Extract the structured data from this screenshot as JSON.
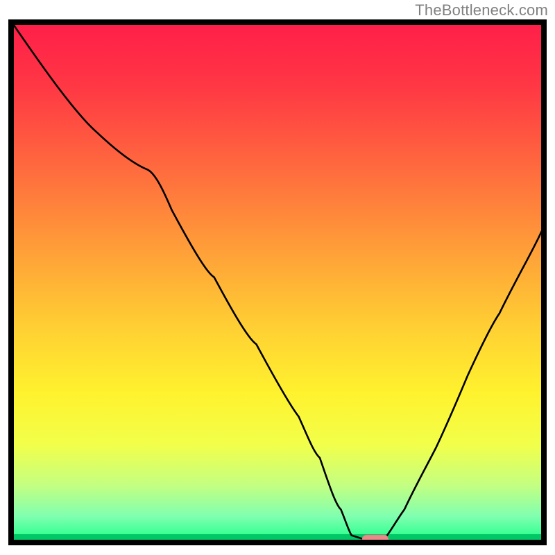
{
  "watermark": "TheBottleneck.com",
  "chart_data": {
    "type": "line",
    "title": "",
    "xlabel": "",
    "ylabel": "",
    "xlim": [
      0,
      100
    ],
    "ylim": [
      0,
      100
    ],
    "background_gradient": {
      "stops": [
        {
          "offset": 0.0,
          "color": "#ff1f49"
        },
        {
          "offset": 0.12,
          "color": "#ff3744"
        },
        {
          "offset": 0.28,
          "color": "#ff6a3e"
        },
        {
          "offset": 0.45,
          "color": "#ffa238"
        },
        {
          "offset": 0.6,
          "color": "#ffd233"
        },
        {
          "offset": 0.72,
          "color": "#fff22e"
        },
        {
          "offset": 0.82,
          "color": "#f2ff4a"
        },
        {
          "offset": 0.9,
          "color": "#c3ff82"
        },
        {
          "offset": 0.96,
          "color": "#7fffb0"
        },
        {
          "offset": 1.0,
          "color": "#2fff8f"
        }
      ]
    },
    "series": [
      {
        "name": "bottleneck-curve",
        "x": [
          0,
          8,
          16,
          24,
          25,
          30,
          38,
          46,
          54,
          58,
          62,
          64,
          67,
          70,
          74,
          80,
          86,
          92,
          100
        ],
        "y": [
          100,
          91,
          82,
          73,
          72,
          64,
          51,
          38,
          24,
          16,
          6,
          1,
          0,
          0,
          6,
          18,
          32,
          44,
          60
        ]
      }
    ],
    "marker": {
      "name": "optimal-point",
      "x": 68,
      "y": 0,
      "color": "#ff7f7f",
      "width": 5,
      "height": 2
    },
    "axes": {
      "show_ticks": false,
      "grid": false,
      "border_color": "#000000",
      "baseline_green": "#00c96b"
    }
  }
}
